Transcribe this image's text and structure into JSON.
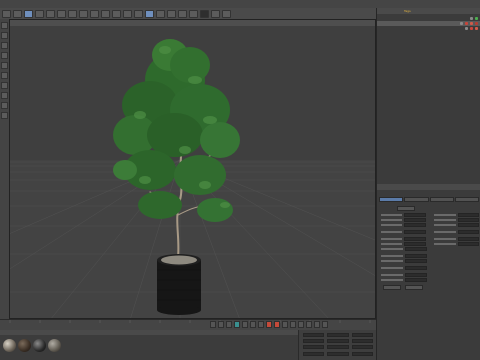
{
  "menubar": {
    "items": [
      "",
      "",
      "",
      "",
      "",
      "",
      "",
      "",
      "",
      "",
      "",
      "",
      "",
      "",
      "",
      "",
      "",
      "",
      ""
    ]
  },
  "viewport": {
    "menu_items": [
      "",
      "",
      "",
      "",
      "",
      ""
    ],
    "status_text": ""
  },
  "object_manager": {
    "menu_items": [
      "",
      "",
      "",
      "",
      "",
      "",
      "Tags",
      ""
    ],
    "rows": [
      {
        "label": ""
      },
      {
        "label": ""
      },
      {
        "label": ""
      }
    ]
  },
  "attribute_manager": {
    "menu_items": [
      "",
      "",
      "",
      "",
      ""
    ],
    "header": "",
    "tabs": [
      "",
      "",
      "",
      ""
    ]
  },
  "colors": {
    "accent_blue": "#5b7ba8",
    "foliage": "#2f6b2f",
    "pot": "#151515"
  }
}
